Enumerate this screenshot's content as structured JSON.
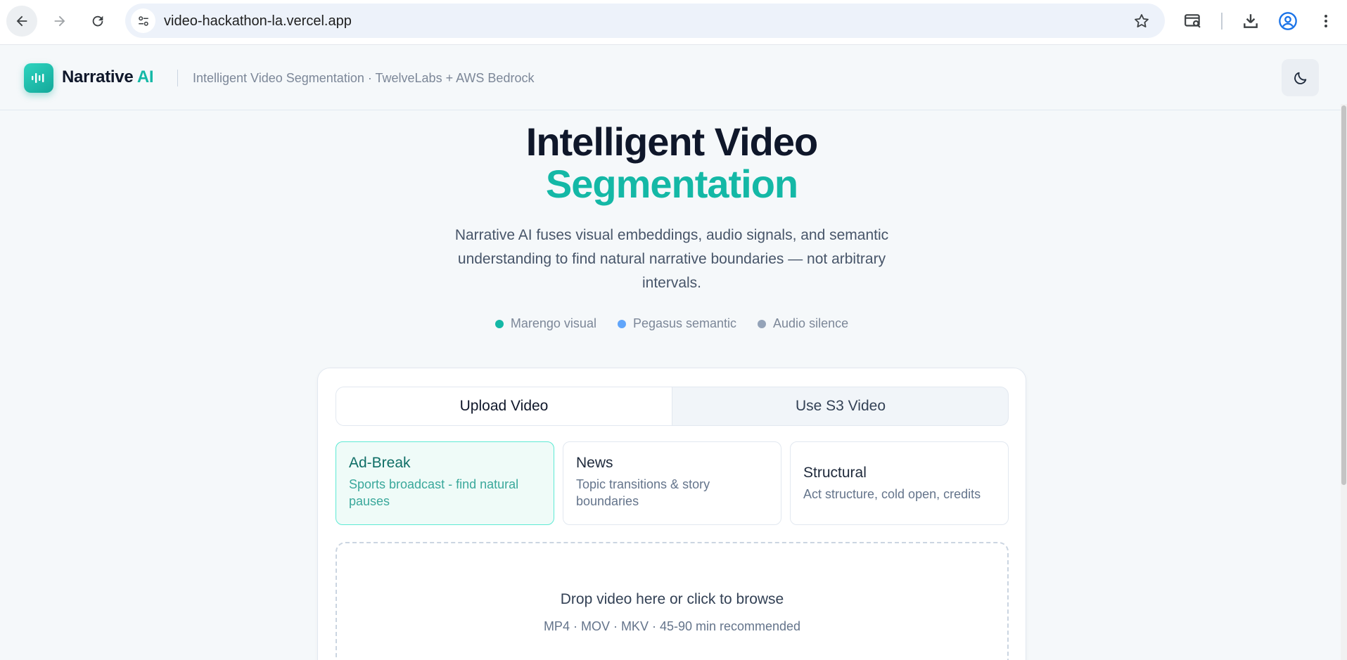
{
  "browser": {
    "url": "video-hackathon-la.vercel.app"
  },
  "header": {
    "brand_main": "Narrative ",
    "brand_accent": "AI",
    "subtitle": "Intelligent Video Segmentation · TwelveLabs + AWS Bedrock"
  },
  "hero": {
    "title_line1": "Intelligent Video",
    "title_line2": "Segmentation",
    "description": "Narrative AI fuses visual embeddings, audio signals, and semantic understanding to find natural narrative boundaries — not arbitrary intervals.",
    "legend": [
      {
        "label": "Marengo visual",
        "color": "#14b8a6"
      },
      {
        "label": "Pegasus semantic",
        "color": "#60a5fa"
      },
      {
        "label": "Audio silence",
        "color": "#94a3b8"
      }
    ]
  },
  "tabs": [
    {
      "label": "Upload Video",
      "active": true
    },
    {
      "label": "Use S3 Video",
      "active": false
    }
  ],
  "modes": [
    {
      "title": "Ad-Break",
      "description": "Sports broadcast - find natural pauses",
      "selected": true
    },
    {
      "title": "News",
      "description": "Topic transitions & story boundaries",
      "selected": false
    },
    {
      "title": "Structural",
      "description": "Act structure, cold open, credits",
      "selected": false
    }
  ],
  "dropzone": {
    "main_text": "Drop video here or click to browse",
    "formats": "MP4 · MOV · MKV · 45-90 min recommended"
  },
  "colors": {
    "accent": "#14b8a6",
    "text_dark": "#0f172a",
    "muted": "#7c8798"
  }
}
